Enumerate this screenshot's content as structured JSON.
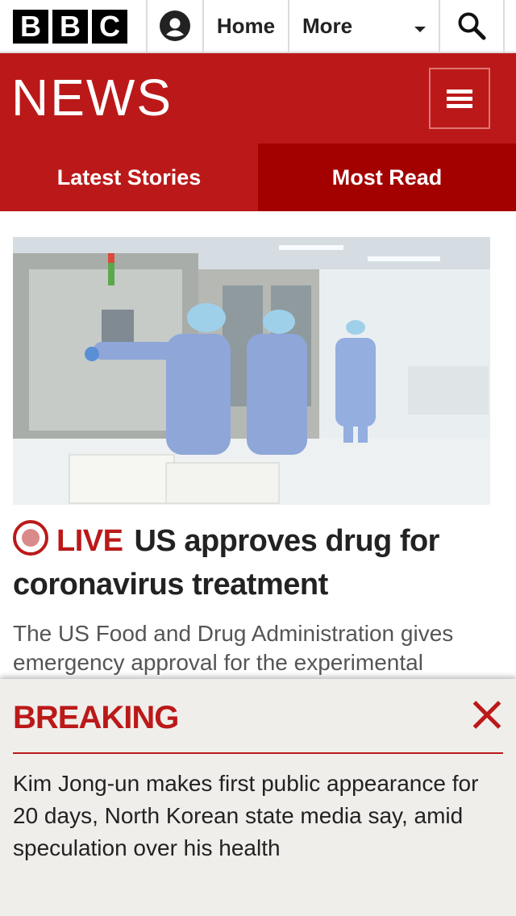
{
  "topbar": {
    "logo_letters": [
      "B",
      "B",
      "C"
    ],
    "account_icon": "user-icon",
    "home_label": "Home",
    "more_label": "More",
    "search_icon": "search-icon"
  },
  "news_header": {
    "title": "NEWS",
    "menu_icon": "hamburger-menu-icon"
  },
  "tabs": [
    {
      "label": "Latest Stories"
    },
    {
      "label": "Most Read"
    }
  ],
  "article": {
    "image_alt": "lab-workers-in-protective-gear",
    "live_label": "LIVE",
    "headline": "US approves drug for coronavirus treatment",
    "summary": "The US Food and Drug Administration gives emergency approval for the experimental"
  },
  "breaking": {
    "title": "BREAKING",
    "close_icon": "close-icon",
    "text": "Kim Jong-un makes first public appearance for 20 days, North Korean state media say, amid speculation over his health"
  },
  "colors": {
    "bbc_red": "#bb1919",
    "tab_dark_red": "#a30000",
    "banner_bg": "#f0eeeb"
  }
}
